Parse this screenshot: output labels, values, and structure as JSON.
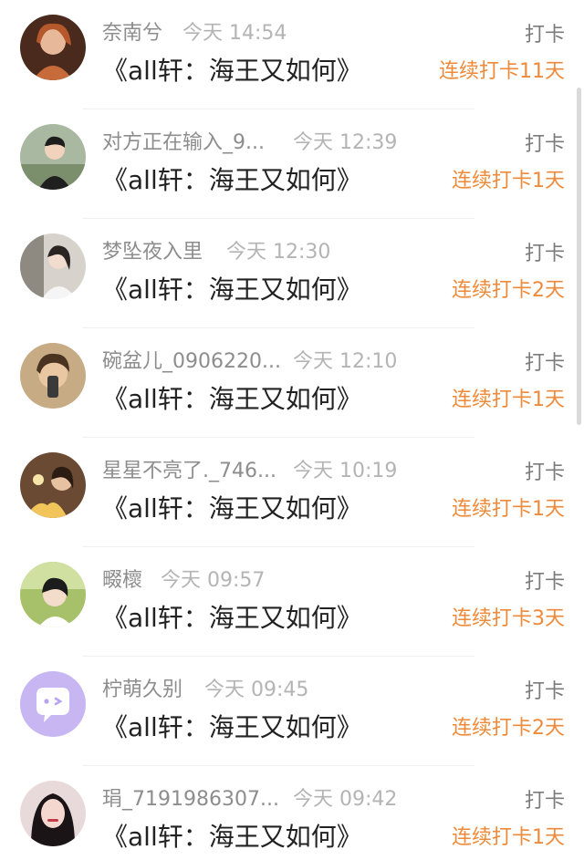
{
  "feed": {
    "rows": [
      {
        "user": "奈南兮",
        "time": "今天 14:54",
        "title": "《all轩：海王又如何》",
        "action": "打卡",
        "streak": "连续打卡11天"
      },
      {
        "user": "对方正在输入_9...",
        "time": "今天 12:39",
        "title": "《all轩：海王又如何》",
        "action": "打卡",
        "streak": "连续打卡1天"
      },
      {
        "user": "梦坠夜入里",
        "time": "今天 12:30",
        "title": "《all轩：海王又如何》",
        "action": "打卡",
        "streak": "连续打卡2天"
      },
      {
        "user": "碗盆儿_0906220...",
        "time": "今天 12:10",
        "title": "《all轩：海王又如何》",
        "action": "打卡",
        "streak": "连续打卡1天"
      },
      {
        "user": "星星不亮了._746...",
        "time": "今天 10:19",
        "title": "《all轩：海王又如何》",
        "action": "打卡",
        "streak": "连续打卡1天"
      },
      {
        "user": "畷櫰",
        "time": "今天 09:57",
        "title": "《all轩：海王又如何》",
        "action": "打卡",
        "streak": "连续打卡3天"
      },
      {
        "user": "柠萌久别",
        "time": "今天 09:45",
        "title": "《all轩：海王又如何》",
        "action": "打卡",
        "streak": "连续打卡2天"
      },
      {
        "user": "琄_7191986307...",
        "time": "今天 09:42",
        "title": "《all轩：海王又如何》",
        "action": "打卡",
        "streak": "连续打卡1天"
      }
    ]
  },
  "colors": {
    "streak": "#ee8a39",
    "name": "#8d8d8d",
    "time": "#b4b4b4",
    "title": "#222222"
  },
  "icons": {
    "avatar_default": "chat-bubble-face-icon"
  }
}
